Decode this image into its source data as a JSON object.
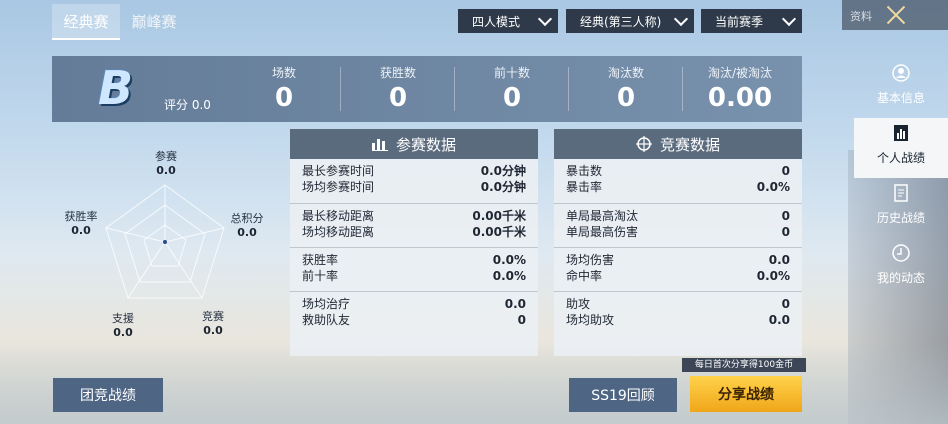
{
  "tabs": [
    {
      "label": "经典赛"
    },
    {
      "label": "巅峰赛"
    }
  ],
  "filters": {
    "mode": "四人模式",
    "perspective": "经典(第三人称)",
    "season": "当前赛季"
  },
  "top_right": {
    "label": "资料"
  },
  "summary": {
    "grade": "B",
    "score_label": "评分 0.0",
    "stats": [
      {
        "label": "场数",
        "value": "0"
      },
      {
        "label": "获胜数",
        "value": "0"
      },
      {
        "label": "前十数",
        "value": "0"
      },
      {
        "label": "淘汰数",
        "value": "0"
      },
      {
        "label": "淘汰/被淘汰",
        "value": "0.00"
      }
    ]
  },
  "radar": {
    "axes": [
      {
        "label": "参赛",
        "value": "0.0"
      },
      {
        "label": "总积分",
        "value": "0.0"
      },
      {
        "label": "竞赛",
        "value": "0.0"
      },
      {
        "label": "支援",
        "value": "0.0"
      },
      {
        "label": "获胜率",
        "value": "0.0"
      }
    ]
  },
  "participation_panel": {
    "title": "参赛数据",
    "groups": [
      [
        {
          "k": "最长参赛时间",
          "v": "0.0分钟"
        },
        {
          "k": "场均参赛时间",
          "v": "0.0分钟"
        }
      ],
      [
        {
          "k": "最长移动距离",
          "v": "0.00千米"
        },
        {
          "k": "场均移动距离",
          "v": "0.00千米"
        }
      ],
      [
        {
          "k": "获胜率",
          "v": "0.0%"
        },
        {
          "k": "前十率",
          "v": "0.0%"
        }
      ],
      [
        {
          "k": "场均治疗",
          "v": "0.0"
        },
        {
          "k": "救助队友",
          "v": "0"
        }
      ]
    ]
  },
  "competition_panel": {
    "title": "竞赛数据",
    "groups": [
      [
        {
          "k": "暴击数",
          "v": "0"
        },
        {
          "k": "暴击率",
          "v": "0.0%"
        }
      ],
      [
        {
          "k": "单局最高淘汰",
          "v": "0"
        },
        {
          "k": "单局最高伤害",
          "v": "0"
        }
      ],
      [
        {
          "k": "场均伤害",
          "v": "0.0"
        },
        {
          "k": "命中率",
          "v": "0.0%"
        }
      ],
      [
        {
          "k": "助攻",
          "v": "0"
        },
        {
          "k": "场均助攻",
          "v": "0.0"
        }
      ]
    ]
  },
  "buttons": {
    "team": "团竞战绩",
    "review": "SS19回顾",
    "share": "分享战绩",
    "share_tip": "每日首次分享得100金币"
  },
  "side_nav": [
    {
      "label": "基本信息",
      "icon": "profile-icon"
    },
    {
      "label": "个人战绩",
      "icon": "stats-icon"
    },
    {
      "label": "历史战绩",
      "icon": "history-icon"
    },
    {
      "label": "我的动态",
      "icon": "moments-icon"
    }
  ],
  "colors": {
    "header": "#5b6b7e",
    "gold": "#f5b423",
    "dark": "#2e3a4a"
  }
}
